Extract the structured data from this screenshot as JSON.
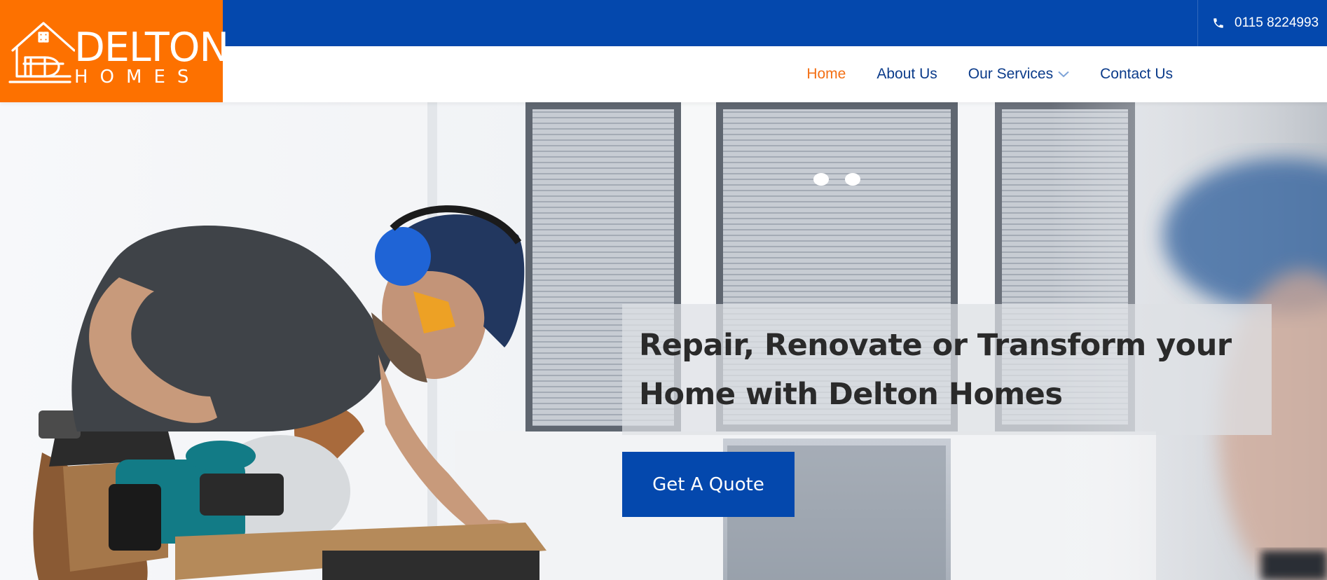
{
  "brand": {
    "name_top": "DELTON",
    "name_bottom": "HOMES",
    "logo_icon": "house-outline-icon",
    "color": "#fd7100"
  },
  "topbar": {
    "phone_icon": "phone-icon",
    "phone": "0115 8224993",
    "color": "#0448ad"
  },
  "nav": {
    "items": [
      {
        "label": "Home",
        "active": true
      },
      {
        "label": "About Us"
      },
      {
        "label": "Our Services",
        "dropdown_icon": "chevron-down-icon"
      },
      {
        "label": "Contact Us"
      }
    ],
    "active_color": "#f36f14",
    "text_color": "#0b3b8a"
  },
  "hero": {
    "image": "worker-with-circular-saw-photo",
    "title_line1": "Repair, Renovate or Transform your",
    "title_line2": "Home with Delton Homes",
    "cta_label": "Get A Quote"
  }
}
